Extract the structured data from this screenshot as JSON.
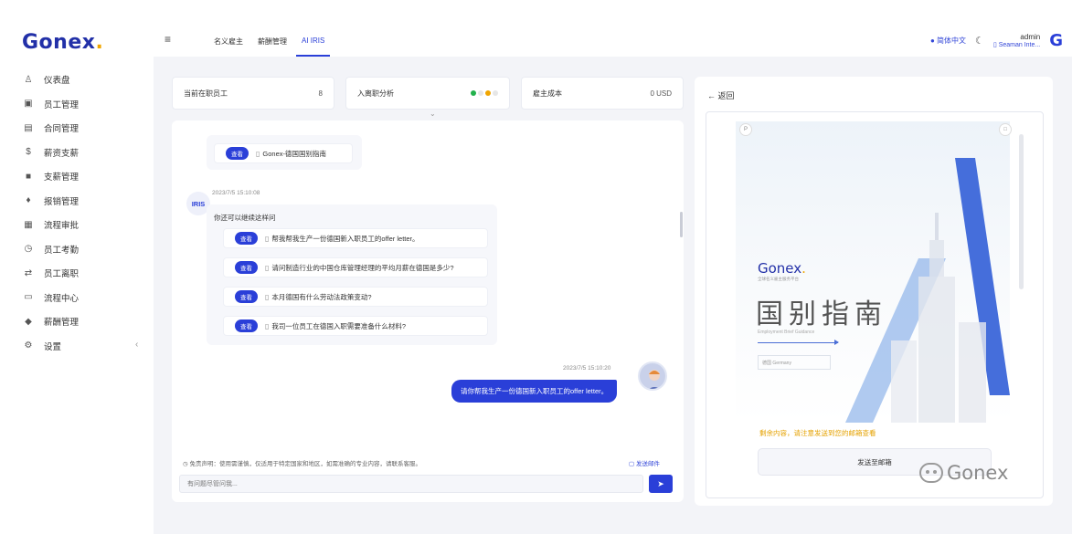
{
  "brand": {
    "logo": "Gonex",
    "logo_dot": "."
  },
  "sidebar": {
    "items": [
      {
        "icon": "dashboard-icon",
        "glyph": "♙",
        "label": "仪表盘"
      },
      {
        "icon": "employee-icon",
        "glyph": "▣",
        "label": "员工管理"
      },
      {
        "icon": "contract-icon",
        "glyph": "▤",
        "label": "合同管理"
      },
      {
        "icon": "salary-icon",
        "glyph": "$",
        "label": "薪资支薪"
      },
      {
        "icon": "payment-icon",
        "glyph": "■",
        "label": "支薪管理"
      },
      {
        "icon": "reimburse-icon",
        "glyph": "♦",
        "label": "报销管理"
      },
      {
        "icon": "approval-icon",
        "glyph": "▦",
        "label": "流程审批"
      },
      {
        "icon": "attendance-icon",
        "glyph": "◷",
        "label": "员工考勤"
      },
      {
        "icon": "transfer-icon",
        "glyph": "⇄",
        "label": "员工离职"
      },
      {
        "icon": "process-icon",
        "glyph": "▭",
        "label": "流程中心"
      },
      {
        "icon": "car-icon",
        "glyph": "◆",
        "label": "薪酬管理"
      },
      {
        "icon": "settings-icon",
        "glyph": "⚙",
        "label": "设置"
      }
    ],
    "collapse": "‹"
  },
  "header": {
    "menu": "≡",
    "tabs": [
      {
        "label": "名义雇主"
      },
      {
        "label": "薪酬管理"
      },
      {
        "label": "AI IRIS",
        "active": true
      }
    ],
    "language": "● 简体中文",
    "theme": "☾",
    "user_name": "admin",
    "user_company": "▯ Seaman Inte...",
    "avatar": "G"
  },
  "stats": [
    {
      "label": "当前在职员工",
      "value": "8"
    },
    {
      "label": "入离职分析",
      "value": ""
    },
    {
      "label": "雇主成本",
      "value": "0 USD"
    }
  ],
  "status_dots": [
    "#22b14c",
    "#e6e6e6",
    "#f0a500",
    "#e6e6e6"
  ],
  "chat": {
    "first_link": {
      "badge": "查看",
      "text": "Gonex-德国国别指南"
    },
    "iris_label": "IRIS",
    "timestamp_iris": "2023/7/5 15:10:08",
    "greeting": "你还可以继续这样问",
    "suggestions": [
      {
        "badge": "查看",
        "text": "帮我帮我生产一份德国新入职员工的offer letter。"
      },
      {
        "badge": "查看",
        "text": "请问制造行业的中国仓库管理经理的平均月薪在德国是多少?"
      },
      {
        "badge": "查看",
        "text": "本月德国有什么劳动法政策变动?"
      },
      {
        "badge": "查看",
        "text": "我司一位员工在德国入职需要准备什么材料?"
      }
    ],
    "timestamp_user": "2023/7/5 15:10:20",
    "user_message": "请你帮我生产一份德国新入职员工的offer letter。",
    "disclaimer": "◷ 免责声明：使用需谨慎，仅适用于特定国家和地区，如需准确的专业内容，请联系客服。",
    "suggest_link": "▢ 发送邮件",
    "input_placeholder": "有问题尽管问我...",
    "send": "➤"
  },
  "preview": {
    "back": "← 返回",
    "cover_logo": "Gonex",
    "cover_sub": "全球名义雇主服务平台",
    "cover_title": "国别指南",
    "cover_en": "Employment Brief Guidance",
    "cover_box": "德国 Germany",
    "cta_text": "剩余内容，请注意发送到您的邮箱查看",
    "cta_button": "发送至邮箱",
    "page_left": "P",
    "page_right": "□"
  },
  "watermark": "Gonex",
  "colors": {
    "primary": "#2a3fd8",
    "accent": "#f0a500"
  }
}
